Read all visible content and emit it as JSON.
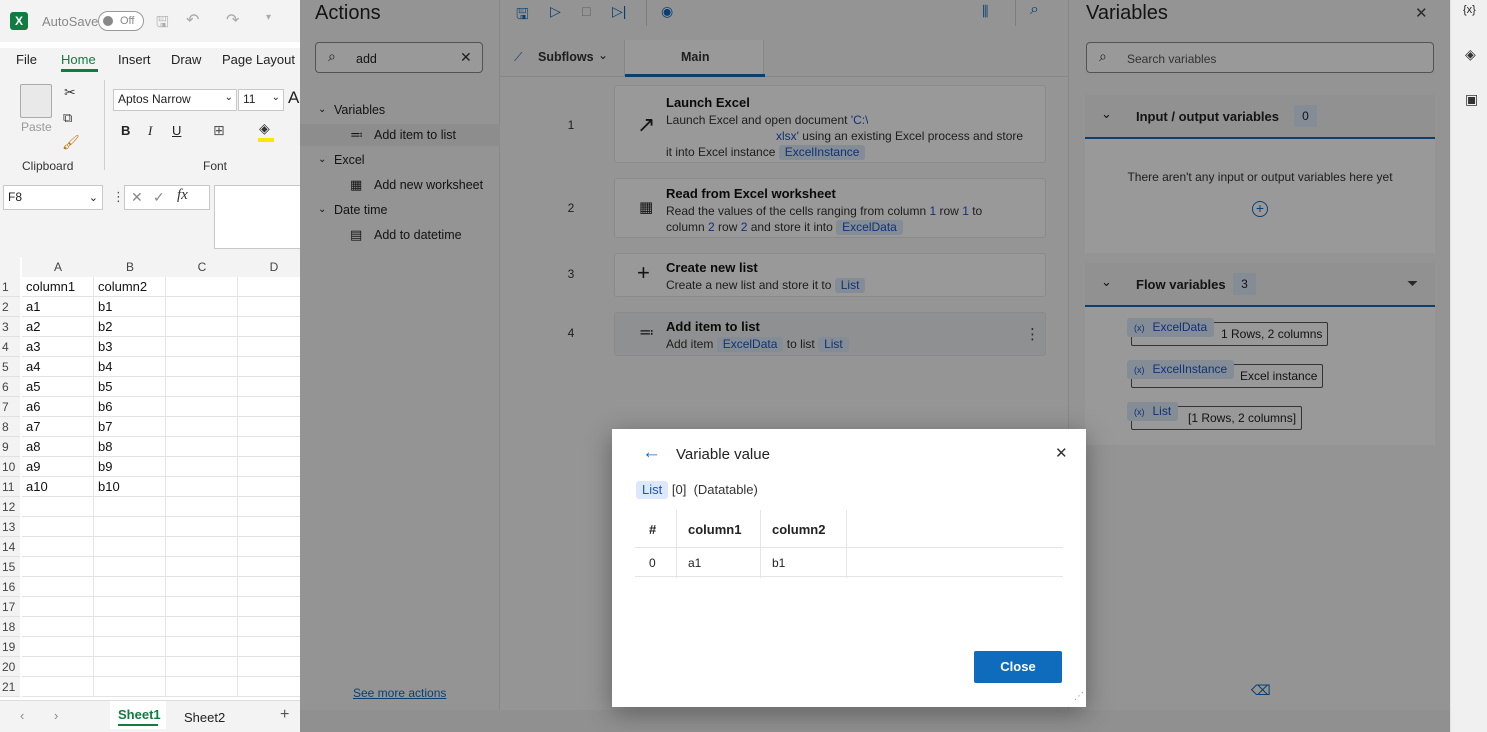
{
  "excel": {
    "autosave_label": "AutoSave",
    "autosave_state": "Off",
    "tabs": [
      "File",
      "Home",
      "Insert",
      "Draw",
      "Page Layout"
    ],
    "active_tab": "Home",
    "paste_label": "Paste",
    "clipboard_label": "Clipboard",
    "font_group_label": "Font",
    "font_name": "Aptos Narrow",
    "font_size": "11",
    "bold": "B",
    "italic": "I",
    "underline": "U",
    "name_box": "F8",
    "fx": "fx",
    "columns": [
      "A",
      "B",
      "C",
      "D"
    ],
    "rows": [
      [
        "1",
        "column1",
        "column2"
      ],
      [
        "2",
        "a1",
        "b1"
      ],
      [
        "3",
        "a2",
        "b2"
      ],
      [
        "4",
        "a3",
        "b3"
      ],
      [
        "5",
        "a4",
        "b4"
      ],
      [
        "6",
        "a5",
        "b5"
      ],
      [
        "7",
        "a6",
        "b6"
      ],
      [
        "8",
        "a7",
        "b7"
      ],
      [
        "9",
        "a8",
        "b8"
      ],
      [
        "10",
        "a9",
        "b9"
      ],
      [
        "11",
        "a10",
        "b10"
      ],
      [
        "12",
        "",
        ""
      ],
      [
        "13",
        "",
        ""
      ],
      [
        "14",
        "",
        ""
      ],
      [
        "15",
        "",
        ""
      ],
      [
        "16",
        "",
        ""
      ],
      [
        "17",
        "",
        ""
      ],
      [
        "18",
        "",
        ""
      ],
      [
        "19",
        "",
        ""
      ],
      [
        "20",
        "",
        ""
      ],
      [
        "21",
        "",
        ""
      ]
    ],
    "sheets": [
      "Sheet1",
      "Sheet2"
    ],
    "active_sheet": "Sheet1"
  },
  "actions_panel": {
    "title": "Actions",
    "search_value": "add",
    "groups": [
      {
        "label": "Variables",
        "items": [
          "Add item to list"
        ]
      },
      {
        "label": "Excel",
        "items": [
          "Add new worksheet"
        ]
      },
      {
        "label": "Date time",
        "items": [
          "Add to datetime"
        ]
      }
    ],
    "see_more": "See more actions"
  },
  "designer": {
    "subflows_label": "Subflows",
    "main_tab": "Main",
    "steps": [
      {
        "num": "1",
        "title": "Launch Excel",
        "line1_pre": "Launch Excel and open document ",
        "line1_path": "'C:\\",
        "line2_path": "xlsx'",
        "line2_post": " using an existing Excel process and store",
        "line3_pre": "it into Excel instance ",
        "line3_var": "ExcelInstance"
      },
      {
        "num": "2",
        "title": "Read from Excel worksheet",
        "line1_pre": "Read the values of the cells ranging from column ",
        "col1": "1",
        "row_word": " row ",
        "row1": "1",
        "to_word": " to",
        "line2_pre": "column ",
        "col2": "2",
        "row2": "2",
        "store_word": " and store it into ",
        "var": "ExcelData"
      },
      {
        "num": "3",
        "title": "Create new list",
        "desc_pre": "Create a new list and store it to ",
        "var": "List"
      },
      {
        "num": "4",
        "title": "Add item to list",
        "desc_pre": "Add item ",
        "var1": "ExcelData",
        "mid": " to list ",
        "var2": "List"
      }
    ]
  },
  "variables_panel": {
    "title": "Variables",
    "search_placeholder": "Search variables",
    "io_section": "Input / output variables",
    "io_count": "0",
    "io_empty": "There aren't any input or output variables here yet",
    "flow_section": "Flow variables",
    "flow_count": "3",
    "flow_vars": [
      {
        "name": "ExcelData",
        "value": "1 Rows, 2 columns"
      },
      {
        "name": "ExcelInstance",
        "value": "Excel instance"
      },
      {
        "name": "List",
        "value": "[1 Rows, 2 columns]"
      }
    ],
    "var_prefix": "(x)"
  },
  "rail": {
    "vars_glyph": "{x}"
  },
  "modal": {
    "title": "Variable value",
    "var_name": "List",
    "index": "[0]",
    "type": "(Datatable)",
    "headers": [
      "#",
      "column1",
      "column2"
    ],
    "rows": [
      [
        "0",
        "a1",
        "b1"
      ]
    ],
    "close_label": "Close"
  },
  "colors": {
    "accent": "#0f6cbd",
    "excel_green": "#107c41",
    "chip_bg": "#dde9fa",
    "chip_text": "#1a56c4"
  }
}
